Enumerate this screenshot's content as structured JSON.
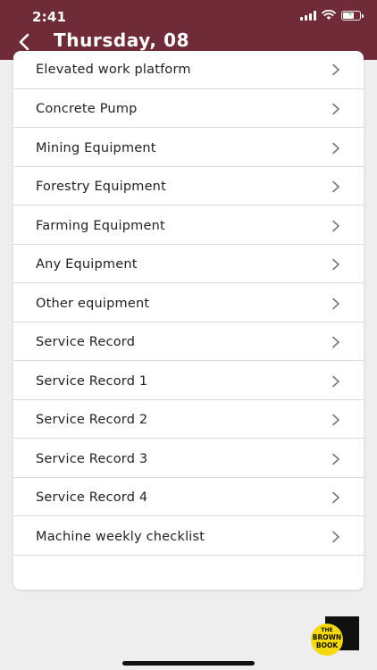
{
  "status_bar": {
    "time": "2:41"
  },
  "header": {
    "title": "Thursday, 08",
    "background_color": "#6f2b37"
  },
  "list": {
    "items": [
      {
        "label": "Elevated work platform"
      },
      {
        "label": "Concrete Pump"
      },
      {
        "label": "Mining Equipment"
      },
      {
        "label": "Forestry Equipment"
      },
      {
        "label": "Farming Equipment"
      },
      {
        "label": "Any Equipment"
      },
      {
        "label": "Other equipment"
      },
      {
        "label": "Service Record"
      },
      {
        "label": "Service Record 1"
      },
      {
        "label": "Service Record 2"
      },
      {
        "label": "Service Record 3"
      },
      {
        "label": "Service Record 4"
      },
      {
        "label": "Machine weekly checklist"
      }
    ]
  },
  "brand": {
    "logo_lines": [
      "THE",
      "BROWN",
      "BOOK"
    ],
    "logo_color": "#f5d90a"
  },
  "icons": {
    "back": "chevron-left-icon",
    "row": "chevron-right-icon"
  }
}
